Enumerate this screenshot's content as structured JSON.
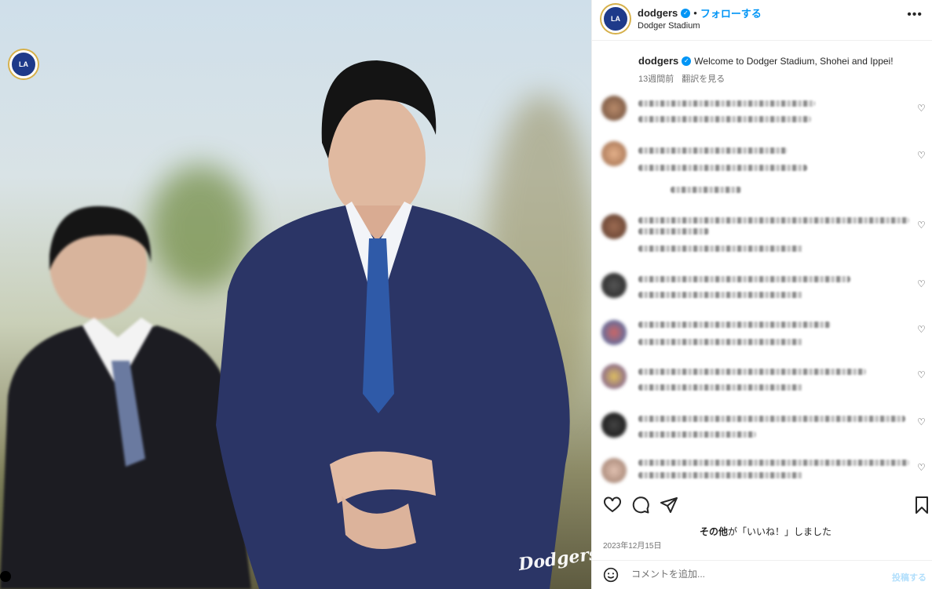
{
  "post": {
    "username": "dodgers",
    "follow_label": "フォローする",
    "location": "Dodger Stadium",
    "photo_watermark": "Dodgers"
  },
  "caption": {
    "username": "dodgers",
    "text": "Welcome to Dodger Stadium, Shohei and Ippei!",
    "age": "13週間前",
    "translate": "翻訳を見る"
  },
  "likes": {
    "who": "その他",
    "text": "が「いいね！」しました"
  },
  "date": "2023年12月15日",
  "comment_box": {
    "placeholder": "コメントを追加...",
    "post_label": "投稿する"
  },
  "icons": [
    "verified-badge",
    "more-options",
    "heart",
    "comment",
    "share",
    "bookmark",
    "emoji"
  ],
  "colors": {
    "accent": "#0095f6",
    "text": "#262626",
    "muted": "#737373"
  }
}
